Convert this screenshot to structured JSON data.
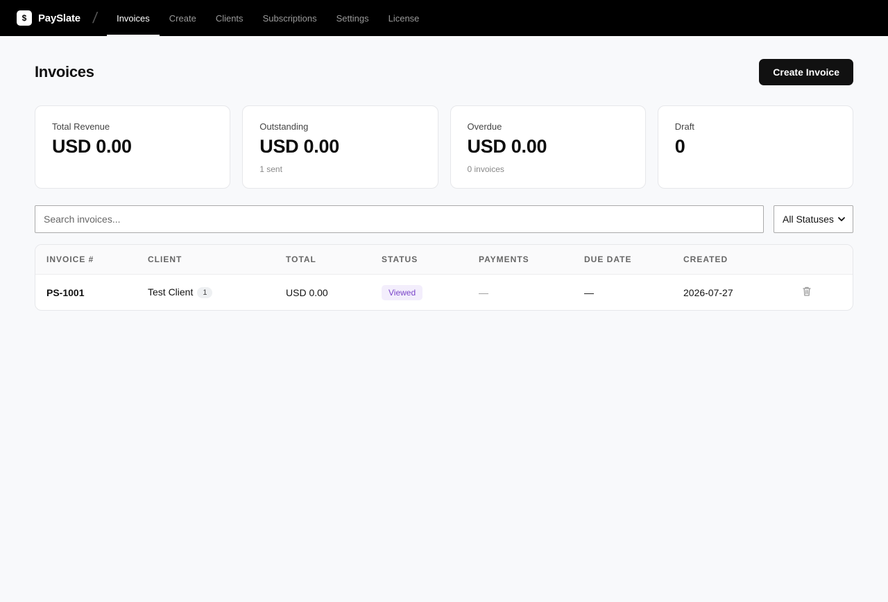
{
  "brand": {
    "name": "PaySlate",
    "logo_glyph": "$"
  },
  "nav": {
    "items": [
      {
        "label": "Invoices",
        "active": true
      },
      {
        "label": "Create",
        "active": false
      },
      {
        "label": "Clients",
        "active": false
      },
      {
        "label": "Subscriptions",
        "active": false
      },
      {
        "label": "Settings",
        "active": false
      },
      {
        "label": "License",
        "active": false
      }
    ]
  },
  "page": {
    "title": "Invoices",
    "create_button": "Create Invoice"
  },
  "stats": [
    {
      "label": "Total Revenue",
      "value": "USD 0.00",
      "sub": ""
    },
    {
      "label": "Outstanding",
      "value": "USD 0.00",
      "sub": "1 sent"
    },
    {
      "label": "Overdue",
      "value": "USD 0.00",
      "sub": "0 invoices"
    },
    {
      "label": "Draft",
      "value": "0",
      "sub": ""
    }
  ],
  "filters": {
    "search_placeholder": "Search invoices...",
    "search_value": "",
    "status_selected": "All Statuses"
  },
  "table": {
    "columns": [
      "INVOICE #",
      "CLIENT",
      "TOTAL",
      "STATUS",
      "PAYMENTS",
      "DUE DATE",
      "CREATED"
    ],
    "rows": [
      {
        "invoice": "PS-1001",
        "client": "Test Client",
        "client_count": "1",
        "total": "USD 0.00",
        "status": "Viewed",
        "payments": "—",
        "due_date": "—",
        "created": "2026-07-27"
      }
    ]
  },
  "colors": {
    "status_viewed_bg": "#f3eefc",
    "status_viewed_fg": "#7a45c9",
    "primary": "#111111"
  },
  "icons": {
    "delete": "trash-icon",
    "dropdown": "chevron-down-icon"
  }
}
